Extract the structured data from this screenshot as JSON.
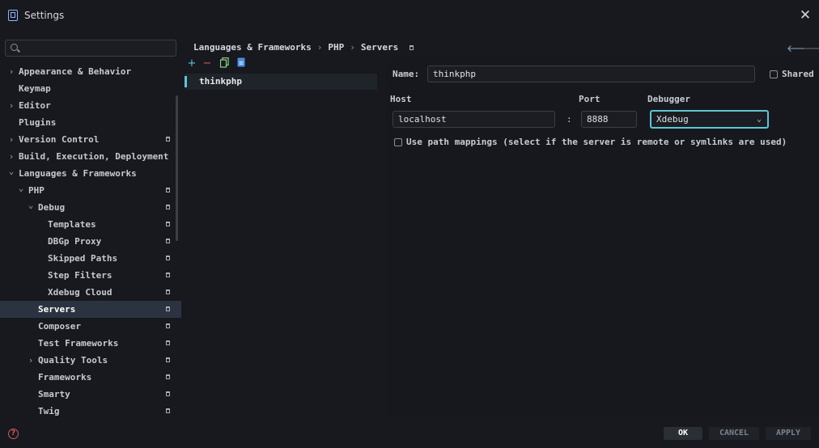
{
  "window": {
    "title": "Settings"
  },
  "search": {
    "placeholder": ""
  },
  "tree": [
    {
      "label": "Appearance & Behavior",
      "indent": 0,
      "chevron": "right",
      "pin": false,
      "selected": false
    },
    {
      "label": "Keymap",
      "indent": 0,
      "chevron": "",
      "pin": false,
      "selected": false
    },
    {
      "label": "Editor",
      "indent": 0,
      "chevron": "right",
      "pin": false,
      "selected": false
    },
    {
      "label": "Plugins",
      "indent": 0,
      "chevron": "",
      "pin": false,
      "selected": false
    },
    {
      "label": "Version Control",
      "indent": 0,
      "chevron": "right",
      "pin": true,
      "selected": false
    },
    {
      "label": "Build, Execution, Deployment",
      "indent": 0,
      "chevron": "right",
      "pin": false,
      "selected": false
    },
    {
      "label": "Languages & Frameworks",
      "indent": 0,
      "chevron": "down",
      "pin": false,
      "selected": false
    },
    {
      "label": "PHP",
      "indent": 1,
      "chevron": "down",
      "pin": true,
      "selected": false
    },
    {
      "label": "Debug",
      "indent": 2,
      "chevron": "down",
      "pin": true,
      "selected": false
    },
    {
      "label": "Templates",
      "indent": 3,
      "chevron": "",
      "pin": true,
      "selected": false
    },
    {
      "label": "DBGp Proxy",
      "indent": 3,
      "chevron": "",
      "pin": true,
      "selected": false
    },
    {
      "label": "Skipped Paths",
      "indent": 3,
      "chevron": "",
      "pin": true,
      "selected": false
    },
    {
      "label": "Step Filters",
      "indent": 3,
      "chevron": "",
      "pin": true,
      "selected": false
    },
    {
      "label": "Xdebug Cloud",
      "indent": 3,
      "chevron": "",
      "pin": true,
      "selected": false
    },
    {
      "label": "Servers",
      "indent": 2,
      "chevron": "",
      "pin": true,
      "selected": true
    },
    {
      "label": "Composer",
      "indent": 2,
      "chevron": "",
      "pin": true,
      "selected": false
    },
    {
      "label": "Test Frameworks",
      "indent": 2,
      "chevron": "",
      "pin": true,
      "selected": false
    },
    {
      "label": "Quality Tools",
      "indent": 2,
      "chevron": "right",
      "pin": true,
      "selected": false
    },
    {
      "label": "Frameworks",
      "indent": 2,
      "chevron": "",
      "pin": true,
      "selected": false
    },
    {
      "label": "Smarty",
      "indent": 2,
      "chevron": "",
      "pin": true,
      "selected": false
    },
    {
      "label": "Twig",
      "indent": 2,
      "chevron": "",
      "pin": true,
      "selected": false
    }
  ],
  "toolbar": {
    "add": "+",
    "remove": "−"
  },
  "servers": [
    {
      "name": "thinkphp"
    }
  ],
  "breadcrumb": [
    "Languages & Frameworks",
    "PHP",
    "Servers"
  ],
  "form": {
    "name_label": "Name:",
    "name_value": "thinkphp",
    "shared_label": "Shared",
    "host_label": "Host",
    "host_value": "localhost",
    "colon": ":",
    "port_label": "Port",
    "port_value": "8888",
    "debugger_label": "Debugger",
    "debugger_value": "Xdebug",
    "path_mappings_label": "Use path mappings (select if the server is remote or symlinks are used)"
  },
  "buttons": {
    "help": "?",
    "ok": "OK",
    "cancel": "CANCEL",
    "apply": "APPLY"
  },
  "colors": {
    "accent": "#5fc5d8",
    "selection": "#2c3340",
    "background": "#17191e",
    "help": "#d05a5a"
  }
}
